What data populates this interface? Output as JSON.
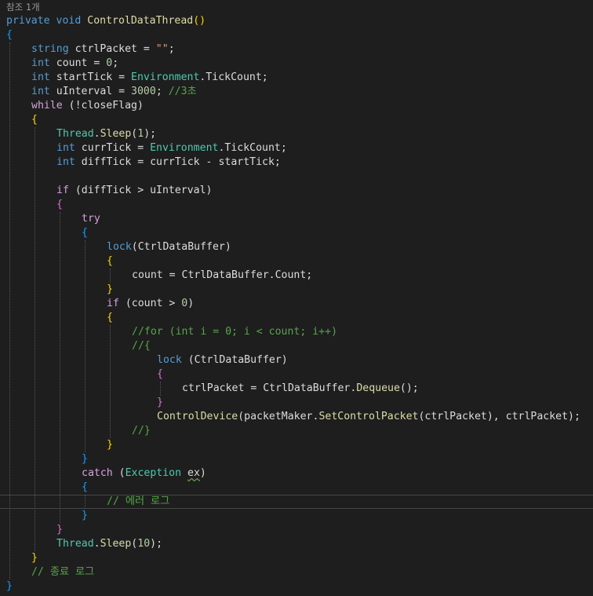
{
  "colors": {
    "background": "#1e1e1e",
    "plain": "#dcdcdc",
    "keyword": "#569cd6",
    "control": "#d8a0df",
    "type": "#4ec9b0",
    "method": "#dcdcaa",
    "string": "#d69d85",
    "number": "#b5cea8",
    "comment": "#57a64a",
    "brace1": "#ffd700",
    "brace2": "#da70d6",
    "brace3": "#179fff",
    "codelens": "#999999"
  },
  "codelens": "참조 1개",
  "code_lines": [
    {
      "indent": 0,
      "tokens": [
        {
          "t": "private",
          "c": "keyword"
        },
        {
          "t": " "
        },
        {
          "t": "void",
          "c": "keyword"
        },
        {
          "t": " "
        },
        {
          "t": "ControlDataThread",
          "c": "method"
        },
        {
          "t": "()",
          "c": "brace1"
        }
      ]
    },
    {
      "indent": 0,
      "tokens": [
        {
          "t": "{",
          "c": "brace3"
        }
      ]
    },
    {
      "indent": 1,
      "tokens": [
        {
          "t": "string",
          "c": "keyword"
        },
        {
          "t": " ctrlPacket = "
        },
        {
          "t": "\"\"",
          "c": "string"
        },
        {
          "t": ";"
        }
      ]
    },
    {
      "indent": 1,
      "tokens": [
        {
          "t": "int",
          "c": "keyword"
        },
        {
          "t": " count = "
        },
        {
          "t": "0",
          "c": "number"
        },
        {
          "t": ";"
        }
      ]
    },
    {
      "indent": 1,
      "tokens": [
        {
          "t": "int",
          "c": "keyword"
        },
        {
          "t": " startTick = "
        },
        {
          "t": "Environment",
          "c": "type"
        },
        {
          "t": ".TickCount;"
        }
      ]
    },
    {
      "indent": 1,
      "tokens": [
        {
          "t": "int",
          "c": "keyword"
        },
        {
          "t": " uInterval = "
        },
        {
          "t": "3000",
          "c": "number"
        },
        {
          "t": "; "
        },
        {
          "t": "//3초",
          "c": "comment"
        }
      ]
    },
    {
      "indent": 1,
      "tokens": [
        {
          "t": "while",
          "c": "control"
        },
        {
          "t": " (!closeFlag)"
        }
      ]
    },
    {
      "indent": 1,
      "tokens": [
        {
          "t": "{",
          "c": "brace1"
        }
      ]
    },
    {
      "indent": 2,
      "tokens": [
        {
          "t": "Thread",
          "c": "type"
        },
        {
          "t": "."
        },
        {
          "t": "Sleep",
          "c": "method"
        },
        {
          "t": "("
        },
        {
          "t": "1",
          "c": "number"
        },
        {
          "t": ");"
        }
      ]
    },
    {
      "indent": 2,
      "tokens": [
        {
          "t": "int",
          "c": "keyword"
        },
        {
          "t": " currTick = "
        },
        {
          "t": "Environment",
          "c": "type"
        },
        {
          "t": ".TickCount;"
        }
      ]
    },
    {
      "indent": 2,
      "tokens": [
        {
          "t": "int",
          "c": "keyword"
        },
        {
          "t": " diffTick = currTick - startTick;"
        }
      ]
    },
    {
      "indent": 2,
      "tokens": []
    },
    {
      "indent": 2,
      "tokens": [
        {
          "t": "if",
          "c": "control"
        },
        {
          "t": " (diffTick > uInterval)"
        }
      ]
    },
    {
      "indent": 2,
      "tokens": [
        {
          "t": "{",
          "c": "brace2"
        }
      ]
    },
    {
      "indent": 3,
      "tokens": [
        {
          "t": "try",
          "c": "control"
        }
      ]
    },
    {
      "indent": 3,
      "tokens": [
        {
          "t": "{",
          "c": "brace3"
        }
      ]
    },
    {
      "indent": 4,
      "tokens": [
        {
          "t": "lock",
          "c": "keyword"
        },
        {
          "t": "(CtrlDataBuffer)"
        }
      ]
    },
    {
      "indent": 4,
      "tokens": [
        {
          "t": "{",
          "c": "brace1"
        }
      ]
    },
    {
      "indent": 5,
      "tokens": [
        {
          "t": "count = CtrlDataBuffer.Count;"
        }
      ]
    },
    {
      "indent": 4,
      "tokens": [
        {
          "t": "}",
          "c": "brace1"
        }
      ]
    },
    {
      "indent": 4,
      "tokens": [
        {
          "t": "if",
          "c": "control"
        },
        {
          "t": " (count > "
        },
        {
          "t": "0",
          "c": "number"
        },
        {
          "t": ")"
        }
      ]
    },
    {
      "indent": 4,
      "tokens": [
        {
          "t": "{",
          "c": "brace1"
        }
      ]
    },
    {
      "indent": 5,
      "tokens": [
        {
          "t": "//for (int i = 0; i < count; i++)",
          "c": "comment"
        }
      ]
    },
    {
      "indent": 5,
      "tokens": [
        {
          "t": "//{",
          "c": "comment"
        }
      ]
    },
    {
      "indent": 6,
      "tokens": [
        {
          "t": "lock",
          "c": "keyword"
        },
        {
          "t": " (CtrlDataBuffer)"
        }
      ]
    },
    {
      "indent": 6,
      "tokens": [
        {
          "t": "{",
          "c": "brace2"
        }
      ]
    },
    {
      "indent": 7,
      "tokens": [
        {
          "t": "ctrlPacket = CtrlDataBuffer."
        },
        {
          "t": "Dequeue",
          "c": "method"
        },
        {
          "t": "();"
        }
      ]
    },
    {
      "indent": 6,
      "tokens": [
        {
          "t": "}",
          "c": "brace2"
        }
      ]
    },
    {
      "indent": 6,
      "tokens": [
        {
          "t": "ControlDevice",
          "c": "method"
        },
        {
          "t": "(packetMaker."
        },
        {
          "t": "SetControlPacket",
          "c": "method"
        },
        {
          "t": "(ctrlPacket), ctrlPacket);"
        }
      ]
    },
    {
      "indent": 5,
      "tokens": [
        {
          "t": "//}",
          "c": "comment"
        }
      ]
    },
    {
      "indent": 4,
      "tokens": [
        {
          "t": "}",
          "c": "brace1"
        }
      ]
    },
    {
      "indent": 3,
      "tokens": [
        {
          "t": "}",
          "c": "brace3"
        }
      ]
    },
    {
      "indent": 3,
      "tokens": [
        {
          "t": "catch",
          "c": "control"
        },
        {
          "t": " ("
        },
        {
          "t": "Exception",
          "c": "type"
        },
        {
          "t": " "
        },
        {
          "t": "ex",
          "c": "squiggle"
        },
        {
          "t": ")"
        }
      ]
    },
    {
      "indent": 3,
      "tokens": [
        {
          "t": "{",
          "c": "brace3"
        }
      ]
    },
    {
      "indent": 4,
      "tokens": [
        {
          "t": "// 에러 로그",
          "c": "comment"
        }
      ]
    },
    {
      "indent": 3,
      "tokens": [
        {
          "t": "}",
          "c": "brace3"
        }
      ]
    },
    {
      "indent": 2,
      "tokens": [
        {
          "t": "}",
          "c": "brace2"
        }
      ]
    },
    {
      "indent": 2,
      "tokens": [
        {
          "t": "Thread",
          "c": "type"
        },
        {
          "t": "."
        },
        {
          "t": "Sleep",
          "c": "method"
        },
        {
          "t": "("
        },
        {
          "t": "10",
          "c": "number"
        },
        {
          "t": ");"
        }
      ]
    },
    {
      "indent": 1,
      "tokens": [
        {
          "t": "}",
          "c": "brace1"
        }
      ]
    },
    {
      "indent": 1,
      "tokens": [
        {
          "t": "// 종료 로그",
          "c": "comment"
        }
      ]
    },
    {
      "indent": 0,
      "tokens": [
        {
          "t": "}",
          "c": "brace3"
        }
      ]
    }
  ]
}
